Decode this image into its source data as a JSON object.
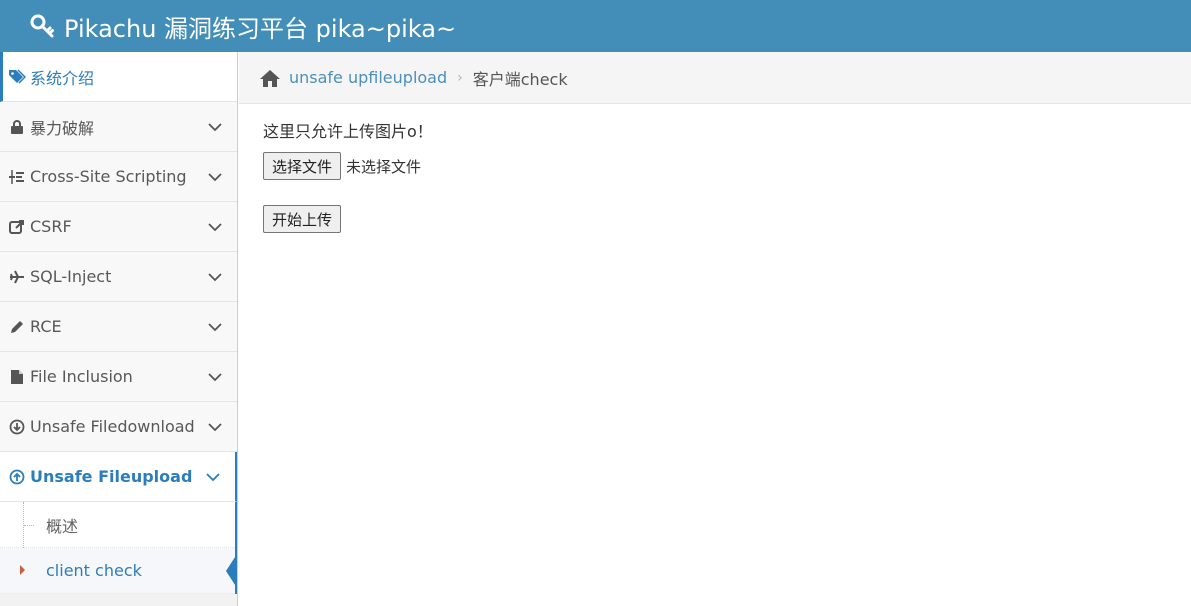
{
  "header": {
    "brand": "Pikachu 漏洞练习平台 pika~pika~",
    "icon": "key-icon"
  },
  "sidebar": {
    "items": [
      {
        "label": "系统介绍",
        "icon": "tags-icon"
      },
      {
        "label": "暴力破解",
        "icon": "lock-icon"
      },
      {
        "label": "Cross-Site Scripting",
        "icon": "list-tree-icon"
      },
      {
        "label": "CSRF",
        "icon": "share-square-icon"
      },
      {
        "label": "SQL-Inject",
        "icon": "plane-icon"
      },
      {
        "label": "RCE",
        "icon": "pencil-icon"
      },
      {
        "label": "File Inclusion",
        "icon": "file-icon"
      },
      {
        "label": "Unsafe Filedownload",
        "icon": "download-circle-icon"
      },
      {
        "label": "Unsafe Fileupload",
        "icon": "upload-circle-icon"
      }
    ],
    "submenu": [
      {
        "label": "概述"
      },
      {
        "label": "client check"
      }
    ]
  },
  "breadcrumb": {
    "link": "unsafe upfileupload",
    "separator": "›",
    "current": "客户端check"
  },
  "main": {
    "notice": "这里只允许上传图片o！",
    "choose_file_label": "选择文件",
    "file_status": "未选择文件",
    "upload_label": "开始上传"
  },
  "colors": {
    "navbar": "#438eb9",
    "accent": "#2b7dbc",
    "link": "#4c8fbd"
  }
}
